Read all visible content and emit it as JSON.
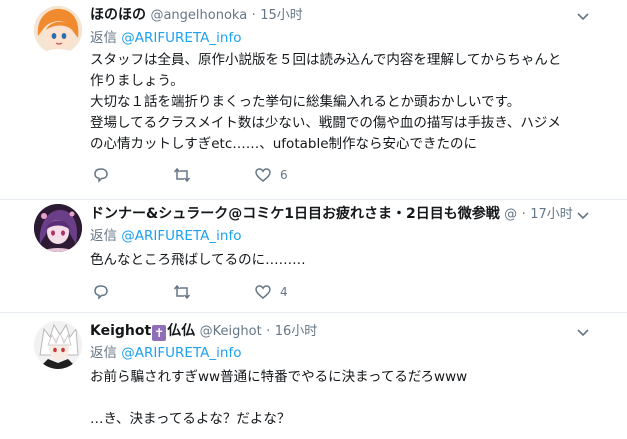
{
  "colors": {
    "accent": "#1da1f2",
    "muted": "#657786",
    "text": "#14171a",
    "divider": "#e6ecf0"
  },
  "reply_prefix": "返信",
  "tweets": [
    {
      "display_name": "ほのほの",
      "handle": "@angelhonoka",
      "dot": "·",
      "time": "15小时",
      "reply_to": "@ARIFURETA_info",
      "lines": [
        "スタッフは全員、原作小説版を５回は読み込んで内容を理解してからちゃんと",
        "作りましょう。",
        "大切な１話を端折りまくった挙句に総集編入れるとか頭おかしいです。",
        "登場してるクラスメイト数は少ない、戦闘での傷や血の描写は手抜き、ハジメ",
        "の心情カットしすぎetc……、ufotable制作なら安心できたのに"
      ],
      "reply_count": "",
      "retweet_count": "",
      "like_count": "6",
      "avatar_icon": "anime-girl-avatar"
    },
    {
      "display_name": "ドンナー&シュラーク@コミケ1日目お疲れさま・2日目も微参戦",
      "handle": "@",
      "dot": "·",
      "time": "17小时",
      "reply_to": "@ARIFURETA_info",
      "lines": [
        "色んなところ飛ばしてるのに………"
      ],
      "reply_count": "",
      "retweet_count": "",
      "like_count": "4",
      "avatar_icon": "anime-character-avatar"
    },
    {
      "display_name_prefix": "Keighot",
      "display_name_cross": "✝",
      "display_name_suffix": "仏仏",
      "handle": "@Keighot",
      "dot": "·",
      "time": "16小时",
      "reply_to": "@ARIFURETA_info",
      "lines": [
        "お前ら騙されすぎww普通に特番でやるに決まってるだろwww",
        "",
        "…き、決まってるよな？だよな？"
      ],
      "avatar_icon": "white-hair-character-avatar"
    }
  ]
}
